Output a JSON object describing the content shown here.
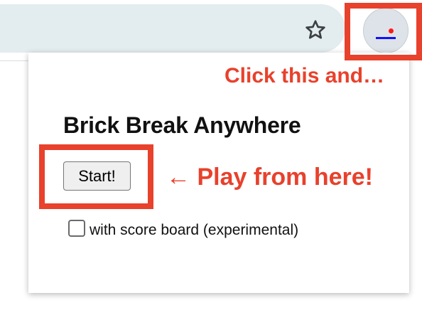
{
  "browser": {
    "star_icon": "star-outline-icon",
    "extension_icon": "brick-break-paddle-ball-icon"
  },
  "popup": {
    "title": "Brick Break Anywhere",
    "start_button_label": "Start!",
    "checkbox_checked": false,
    "checkbox_label": "with score board (experimental)"
  },
  "annotations": {
    "click_text": "Click this and…",
    "play_text": "← Play from here!",
    "color": "#e8412c"
  },
  "colors": {
    "paddle": "#1010ff",
    "ball": "#ff1a1a",
    "address_bar": "#e3ecef"
  }
}
